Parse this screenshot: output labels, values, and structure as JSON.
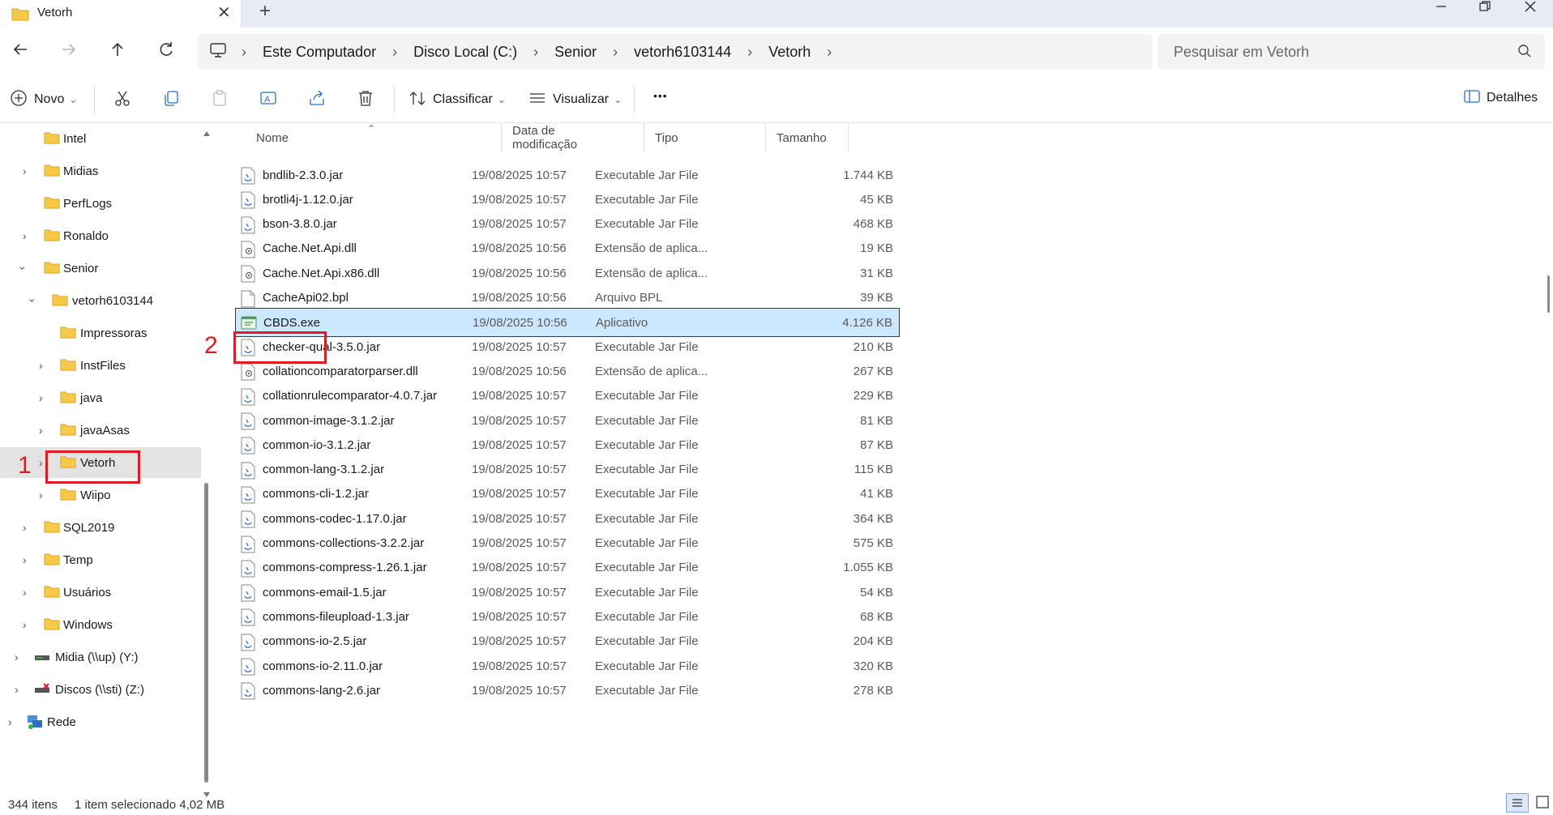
{
  "window": {
    "tab_title": "Vetorh",
    "new_tab_symbol": "+",
    "tab_close_symbol": "✕"
  },
  "breadcrumb": [
    "Este Computador",
    "Disco Local (C:)",
    "Senior",
    "vetorh6103144",
    "Vetorh"
  ],
  "search": {
    "placeholder": "Pesquisar em Vetorh"
  },
  "toolbar": {
    "new_label": "Novo",
    "sort_label": "Classificar",
    "view_label": "Visualizar",
    "more_label": "•••",
    "details_label": "Detalhes"
  },
  "nav_tree": [
    {
      "label": "Intel",
      "expandable": false
    },
    {
      "label": "Midias",
      "expandable": true
    },
    {
      "label": "PerfLogs",
      "expandable": false
    },
    {
      "label": "Ronaldo",
      "expandable": true
    },
    {
      "label": "Senior",
      "expandable": true,
      "expanded": true
    },
    {
      "label": "vetorh6103144",
      "expandable": true,
      "expanded": true
    },
    {
      "label": "Impressoras",
      "expandable": false
    },
    {
      "label": "InstFiles",
      "expandable": true
    },
    {
      "label": "java",
      "expandable": true
    },
    {
      "label": "javaAsas",
      "expandable": true
    },
    {
      "label": "Vetorh",
      "expandable": true,
      "selected": true
    },
    {
      "label": "Wiipo",
      "expandable": true
    },
    {
      "label": "SQL2019",
      "expandable": true
    },
    {
      "label": "Temp",
      "expandable": true
    },
    {
      "label": "Usuários",
      "expandable": true
    },
    {
      "label": "Windows",
      "expandable": true
    },
    {
      "label": "Midia (\\\\up) (Y:)",
      "expandable": true
    },
    {
      "label": "Discos (\\\\sti) (Z:)",
      "expandable": true
    },
    {
      "label": "Rede",
      "expandable": true
    }
  ],
  "columns": {
    "name": "Nome",
    "date": "Data de modificação",
    "type": "Tipo",
    "size": "Tamanho"
  },
  "files": [
    {
      "name": "bndlib-2.3.0.jar",
      "date": "19/08/2025 10:57",
      "type": "Executable Jar File",
      "size": "1.744 KB",
      "icon": "jar-file-icon"
    },
    {
      "name": "brotli4j-1.12.0.jar",
      "date": "19/08/2025 10:57",
      "type": "Executable Jar File",
      "size": "45 KB",
      "icon": "jar-file-icon"
    },
    {
      "name": "bson-3.8.0.jar",
      "date": "19/08/2025 10:57",
      "type": "Executable Jar File",
      "size": "468 KB",
      "icon": "jar-file-icon"
    },
    {
      "name": "Cache.Net.Api.dll",
      "date": "19/08/2025 10:56",
      "type": "Extensão de aplica...",
      "size": "19 KB",
      "icon": "dll-file-icon"
    },
    {
      "name": "Cache.Net.Api.x86.dll",
      "date": "19/08/2025 10:56",
      "type": "Extensão de aplica...",
      "size": "31 KB",
      "icon": "dll-file-icon"
    },
    {
      "name": "CacheApi02.bpl",
      "date": "19/08/2025 10:56",
      "type": "Arquivo BPL",
      "size": "39 KB",
      "icon": "blank-file-icon"
    },
    {
      "name": "CBDS.exe",
      "date": "19/08/2025 10:56",
      "type": "Aplicativo",
      "size": "4.126 KB",
      "icon": "exe-file-icon",
      "selected": true
    },
    {
      "name": "checker-qual-3.5.0.jar",
      "date": "19/08/2025 10:57",
      "type": "Executable Jar File",
      "size": "210 KB",
      "icon": "jar-file-icon"
    },
    {
      "name": "collationcomparatorparser.dll",
      "date": "19/08/2025 10:56",
      "type": "Extensão de aplica...",
      "size": "267 KB",
      "icon": "dll-file-icon"
    },
    {
      "name": "collationrulecomparator-4.0.7.jar",
      "date": "19/08/2025 10:57",
      "type": "Executable Jar File",
      "size": "229 KB",
      "icon": "jar-file-icon"
    },
    {
      "name": "common-image-3.1.2.jar",
      "date": "19/08/2025 10:57",
      "type": "Executable Jar File",
      "size": "81 KB",
      "icon": "jar-file-icon"
    },
    {
      "name": "common-io-3.1.2.jar",
      "date": "19/08/2025 10:57",
      "type": "Executable Jar File",
      "size": "87 KB",
      "icon": "jar-file-icon"
    },
    {
      "name": "common-lang-3.1.2.jar",
      "date": "19/08/2025 10:57",
      "type": "Executable Jar File",
      "size": "115 KB",
      "icon": "jar-file-icon"
    },
    {
      "name": "commons-cli-1.2.jar",
      "date": "19/08/2025 10:57",
      "type": "Executable Jar File",
      "size": "41 KB",
      "icon": "jar-file-icon"
    },
    {
      "name": "commons-codec-1.17.0.jar",
      "date": "19/08/2025 10:57",
      "type": "Executable Jar File",
      "size": "364 KB",
      "icon": "jar-file-icon"
    },
    {
      "name": "commons-collections-3.2.2.jar",
      "date": "19/08/2025 10:57",
      "type": "Executable Jar File",
      "size": "575 KB",
      "icon": "jar-file-icon"
    },
    {
      "name": "commons-compress-1.26.1.jar",
      "date": "19/08/2025 10:57",
      "type": "Executable Jar File",
      "size": "1.055 KB",
      "icon": "jar-file-icon"
    },
    {
      "name": "commons-email-1.5.jar",
      "date": "19/08/2025 10:57",
      "type": "Executable Jar File",
      "size": "54 KB",
      "icon": "jar-file-icon"
    },
    {
      "name": "commons-fileupload-1.3.jar",
      "date": "19/08/2025 10:57",
      "type": "Executable Jar File",
      "size": "68 KB",
      "icon": "jar-file-icon"
    },
    {
      "name": "commons-io-2.5.jar",
      "date": "19/08/2025 10:57",
      "type": "Executable Jar File",
      "size": "204 KB",
      "icon": "jar-file-icon"
    },
    {
      "name": "commons-io-2.11.0.jar",
      "date": "19/08/2025 10:57",
      "type": "Executable Jar File",
      "size": "320 KB",
      "icon": "jar-file-icon"
    },
    {
      "name": "commons-lang-2.6.jar",
      "date": "19/08/2025 10:57",
      "type": "Executable Jar File",
      "size": "278 KB",
      "icon": "jar-file-icon"
    }
  ],
  "status": {
    "item_count": "344 itens",
    "selection": "1 item selecionado  4,02 MB"
  },
  "annotations": {
    "callout_1": "1",
    "callout_2": "2"
  },
  "colors": {
    "selection": "#cce8ff",
    "folder": "#f7c948",
    "callout": "#e01b24"
  }
}
